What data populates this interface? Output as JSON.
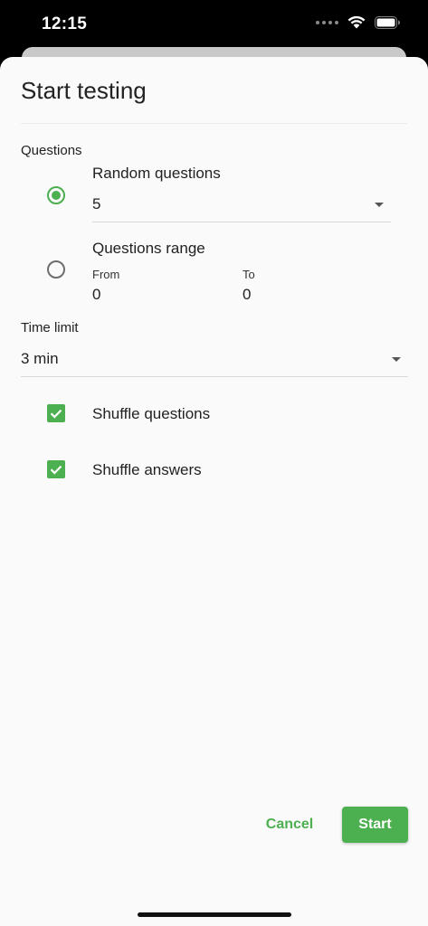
{
  "status_bar": {
    "time": "12:15"
  },
  "dialog": {
    "title": "Start testing",
    "questions_section_label": "Questions",
    "random_option": {
      "label": "Random questions",
      "selected": true,
      "count_value": "5"
    },
    "range_option": {
      "label": "Questions range",
      "selected": false,
      "from_label": "From",
      "from_value": "0",
      "to_label": "To",
      "to_value": "0"
    },
    "time_limit_label": "Time limit",
    "time_limit_value": "3 min",
    "shuffle_questions": {
      "label": "Shuffle questions",
      "checked": true
    },
    "shuffle_answers": {
      "label": "Shuffle answers",
      "checked": true
    },
    "cancel_label": "Cancel",
    "start_label": "Start"
  },
  "colors": {
    "accent": "#4caf50",
    "background": "#fafafa",
    "text": "#222222"
  }
}
